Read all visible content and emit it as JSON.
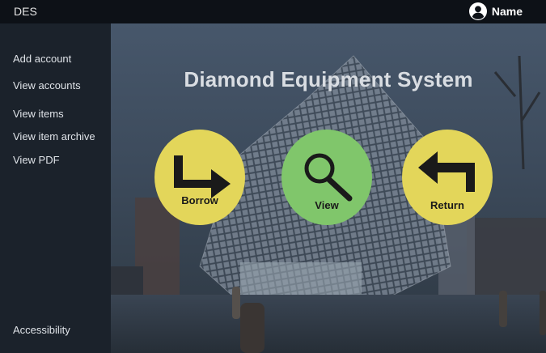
{
  "header": {
    "brand": "DES",
    "user_name": "Name"
  },
  "sidebar": {
    "items": [
      {
        "label": "Add account"
      },
      {
        "label": "View accounts"
      },
      {
        "label": "View items"
      },
      {
        "label": "View item archive"
      },
      {
        "label": "View PDF"
      }
    ],
    "footer_label": "Accessibility"
  },
  "main": {
    "title": "Diamond Equipment System",
    "actions": [
      {
        "label": "Borrow",
        "icon": "arrow-turn-right-icon",
        "color": "#e3d65a"
      },
      {
        "label": "View",
        "icon": "search-icon",
        "color": "#80c66b"
      },
      {
        "label": "Return",
        "icon": "arrow-return-left-icon",
        "color": "#e3d65a"
      }
    ]
  }
}
